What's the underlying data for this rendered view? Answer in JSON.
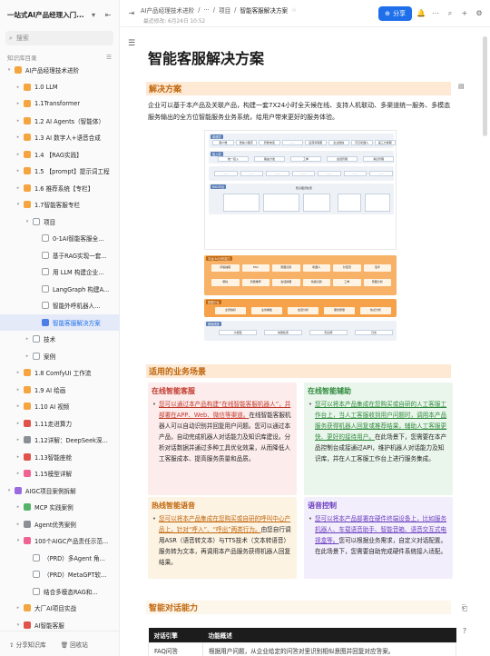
{
  "sidebar": {
    "title": "一站式AI产品经理入门...",
    "search_placeholder": "搜索",
    "section_label": "知识库目录",
    "footer": {
      "share": "分享知识库",
      "trash": "回收站"
    }
  },
  "tree": [
    {
      "label": "AI产品经理技术进阶",
      "depth": 0,
      "icon": "book-icon",
      "color": "orange",
      "arrow": "▾"
    },
    {
      "label": "1.0 LLM",
      "depth": 1,
      "icon": "folder-icon",
      "color": "orange",
      "arrow": "▸"
    },
    {
      "label": "1.1Transformer",
      "depth": 1,
      "icon": "folder-icon",
      "color": "orange",
      "arrow": "▸"
    },
    {
      "label": "1.2 AI Agents（智能体）",
      "depth": 1,
      "icon": "folder-icon",
      "color": "orange",
      "arrow": "▸"
    },
    {
      "label": "1.3 AI 数字人+语音合成",
      "depth": 1,
      "icon": "folder-icon",
      "color": "orange",
      "arrow": "▸"
    },
    {
      "label": "1.4 【RAG实践】",
      "depth": 1,
      "icon": "folder-icon",
      "color": "orange",
      "arrow": "▸"
    },
    {
      "label": "1.5 【prompt】提示词工程",
      "depth": 1,
      "icon": "folder-icon",
      "color": "orange",
      "arrow": "▸"
    },
    {
      "label": "1.6 推荐系统【专栏】",
      "depth": 1,
      "icon": "folder-icon",
      "color": "orange",
      "arrow": "▸"
    },
    {
      "label": "1.7智能客服专栏",
      "depth": 1,
      "icon": "folder-icon",
      "color": "orange",
      "arrow": "▾"
    },
    {
      "label": "项目",
      "depth": 2,
      "icon": "doc-icon",
      "color": "doc",
      "arrow": "▾"
    },
    {
      "label": "0-1AI智能客服全...",
      "depth": 3,
      "icon": "doc-icon",
      "color": "doc",
      "arrow": ""
    },
    {
      "label": "基于RAG实现一套...",
      "depth": 3,
      "icon": "doc-icon",
      "color": "doc",
      "arrow": ""
    },
    {
      "label": "用 LLM 构建企业...",
      "depth": 3,
      "icon": "doc-icon",
      "color": "doc",
      "arrow": ""
    },
    {
      "label": "LangGraph 构建A...",
      "depth": 3,
      "icon": "doc-icon",
      "color": "doc",
      "arrow": ""
    },
    {
      "label": "智能外呼机器人...",
      "depth": 3,
      "icon": "doc-icon",
      "color": "doc",
      "arrow": ""
    },
    {
      "label": "智能客服解决方案",
      "depth": 3,
      "icon": "doc-icon",
      "color": "blue",
      "arrow": "",
      "selected": true
    },
    {
      "label": "技术",
      "depth": 2,
      "icon": "doc-icon",
      "color": "doc",
      "arrow": "▸"
    },
    {
      "label": "案例",
      "depth": 2,
      "icon": "doc-icon",
      "color": "doc",
      "arrow": "▸"
    },
    {
      "label": "1.8 ComfyUI 工作流",
      "depth": 1,
      "icon": "folder-icon",
      "color": "orange",
      "arrow": "▸"
    },
    {
      "label": "1.9 AI 绘画",
      "depth": 1,
      "icon": "folder-icon",
      "color": "orange",
      "arrow": "▸"
    },
    {
      "label": "1.10 AI 视频",
      "depth": 1,
      "icon": "folder-icon",
      "color": "orange",
      "arrow": "▸"
    },
    {
      "label": "1.11走进算力",
      "depth": 1,
      "icon": "rocket-icon",
      "color": "red",
      "arrow": "▸"
    },
    {
      "label": "1.12详解：DeepSeek深...",
      "depth": 1,
      "icon": "gear-icon",
      "color": "gray",
      "arrow": "▸"
    },
    {
      "label": "1.13智能座舱",
      "depth": 1,
      "icon": "car-icon",
      "color": "red",
      "arrow": "▸"
    },
    {
      "label": "1.15模型详解",
      "depth": 1,
      "icon": "scissors-icon",
      "color": "pink",
      "arrow": "▸"
    },
    {
      "label": "AIGC项目案例拆解",
      "depth": 0,
      "icon": "book-icon",
      "color": "purple",
      "arrow": "▾"
    },
    {
      "label": "MCP 实践案例",
      "depth": 1,
      "icon": "puzzle-icon",
      "color": "green",
      "arrow": "▸"
    },
    {
      "label": "Agent优秀案例",
      "depth": 1,
      "icon": "robot-icon",
      "color": "gray",
      "arrow": "▸"
    },
    {
      "label": "100个AIGC产品责任示范...",
      "depth": 1,
      "icon": "star-icon",
      "color": "pink",
      "arrow": "▾"
    },
    {
      "label": "（PRD）多Agent 角...",
      "depth": 2,
      "icon": "doc-icon",
      "color": "doc",
      "arrow": ""
    },
    {
      "label": "（PRD）MetaGPT软...",
      "depth": 2,
      "icon": "doc-icon",
      "color": "doc",
      "arrow": ""
    },
    {
      "label": "结合多模态RAG和...",
      "depth": 2,
      "icon": "doc-icon",
      "color": "doc",
      "arrow": ""
    },
    {
      "label": "大厂AI项目实战",
      "depth": 1,
      "icon": "trophy-icon",
      "color": "orange",
      "arrow": "▸"
    },
    {
      "label": "AI智能客服",
      "depth": 1,
      "icon": "phone-icon",
      "color": "red",
      "arrow": "▾"
    },
    {
      "label": "【集成示例】网页嵌",
      "depth": 2,
      "icon": "doc-icon",
      "color": "doc",
      "arrow": ""
    },
    {
      "label": "【集成示例】钉钉集...",
      "depth": 2,
      "icon": "doc-icon",
      "color": "doc",
      "arrow": ""
    }
  ],
  "topbar": {
    "breadcrumb": [
      "AI产品经理技术进阶",
      "···",
      "项目",
      "智能客服解决方案"
    ],
    "edited": "最近修改: 6月24日 10:52",
    "share_label": "分享"
  },
  "doc": {
    "title": "智能客服解决方案",
    "h_solution": "解决方案",
    "intro": "企业可以基于本产品及关联产品，构建一套7X24小时全天候在线、支持人机联动、多渠道统一服务、多模态服务输出的全方位智能服务业务系统，给用户带来更好的服务体验。",
    "diagram": {
      "row1_tag": "渠道层",
      "row1_items": [
        "客户端",
        "微信小程序",
        "智能电话",
        "······",
        "运营商客服",
        "企业微信",
        "钉钉机器人",
        "第三方客服"
      ],
      "row2_tag": "接入层",
      "row2_items": [
        "统一接入",
        "路由分发",
        "工单",
        "会话管理",
        "消息管理"
      ],
      "row3_tag": "RAG平台",
      "row3_title": "知识图谱检索",
      "row4_tag": "平台(AI)分析能力",
      "row4_items": [
        "问答抽取",
        "FAQ",
        "意图识别",
        "机器人",
        "对话流",
        "话术",
        "质检",
        "智能推荐",
        "会话摘要",
        "情绪识别",
        "工单",
        "意图分析"
      ],
      "row5_tag": "数据中台",
      "row5_items": [
        "全局指标",
        "业务看板",
        "会话分析",
        "服务质量",
        "热点分析"
      ],
      "row6_tag": "基础底座",
      "row6_items": [
        "大模型",
        "向量检索",
        "知识库",
        "日志"
      ]
    },
    "h_scenarios": "适用的业务场景",
    "cards": [
      {
        "title": "在线智能客服",
        "title_color": "#c0392b",
        "bg": "#fdecec",
        "highlight": "您可以通过本产品构建“在线智能客服机器人”，并部署在APP、Web、微信等渠道。",
        "rest": "在线智能客服机器人可以自动识别并回复用户问题。您可以通过本产品，自动完成机器人对话能力及知识库建设。分析对话数据并通过多种工具优化效果，从而降低人工客服成本、提高服务质量和品质。"
      },
      {
        "title": "在线智能辅助",
        "title_color": "#2f8a3c",
        "bg": "#eaf6ec",
        "highlight": "您可以将本产品集成在您购买或自研的人工客服工作台上，当人工客服收到用户问题时，调用本产品服务获得机器人回复或推荐结果，辅助人工客服更快、更好的接待用户。",
        "rest": "在此场景下，您需要在本产品控制台成接通过API，维护机器人对话能力及知识库，并在人工客服工作台上进行服务集成。"
      },
      {
        "title": "热线智能语音",
        "title_color": "#c0660c",
        "bg": "#fdf3e3",
        "highlight": "您可以将本产品集成在您购买或自研的呼叫中心产品上，针对“呼入”、“呼出”两类行为。",
        "rest": "由您自行调用ASR（语音转文本）与TTS技术（文本转语音）服务转为文本，再调用本产品服务获得机器人回复结果。"
      },
      {
        "title": "语音控制",
        "title_color": "#6b3fbf",
        "bg": "#f3eefc",
        "highlight": "您可以将本产品部署在硬件终端设备上，比如服务机器人、车载语音助手、智能音箱、语音交互式电视盒等。",
        "rest": "您可以根据业务需求，自定义对话配置。在此场景下，您需要自助完成硬件系统接入适配。"
      }
    ],
    "h_dialog": "智能对话能力",
    "table": {
      "headers": [
        "对话引擎",
        "功能概述"
      ],
      "rows": [
        [
          "FAQ问答",
          "根据用户问题，从企业给定的问答对里识别相似意图并回复对应答案。"
        ]
      ]
    }
  },
  "colors": {
    "accent": "#1f6feb",
    "heading_bg": "#fde9d4",
    "heading_text": "#c0660c"
  }
}
